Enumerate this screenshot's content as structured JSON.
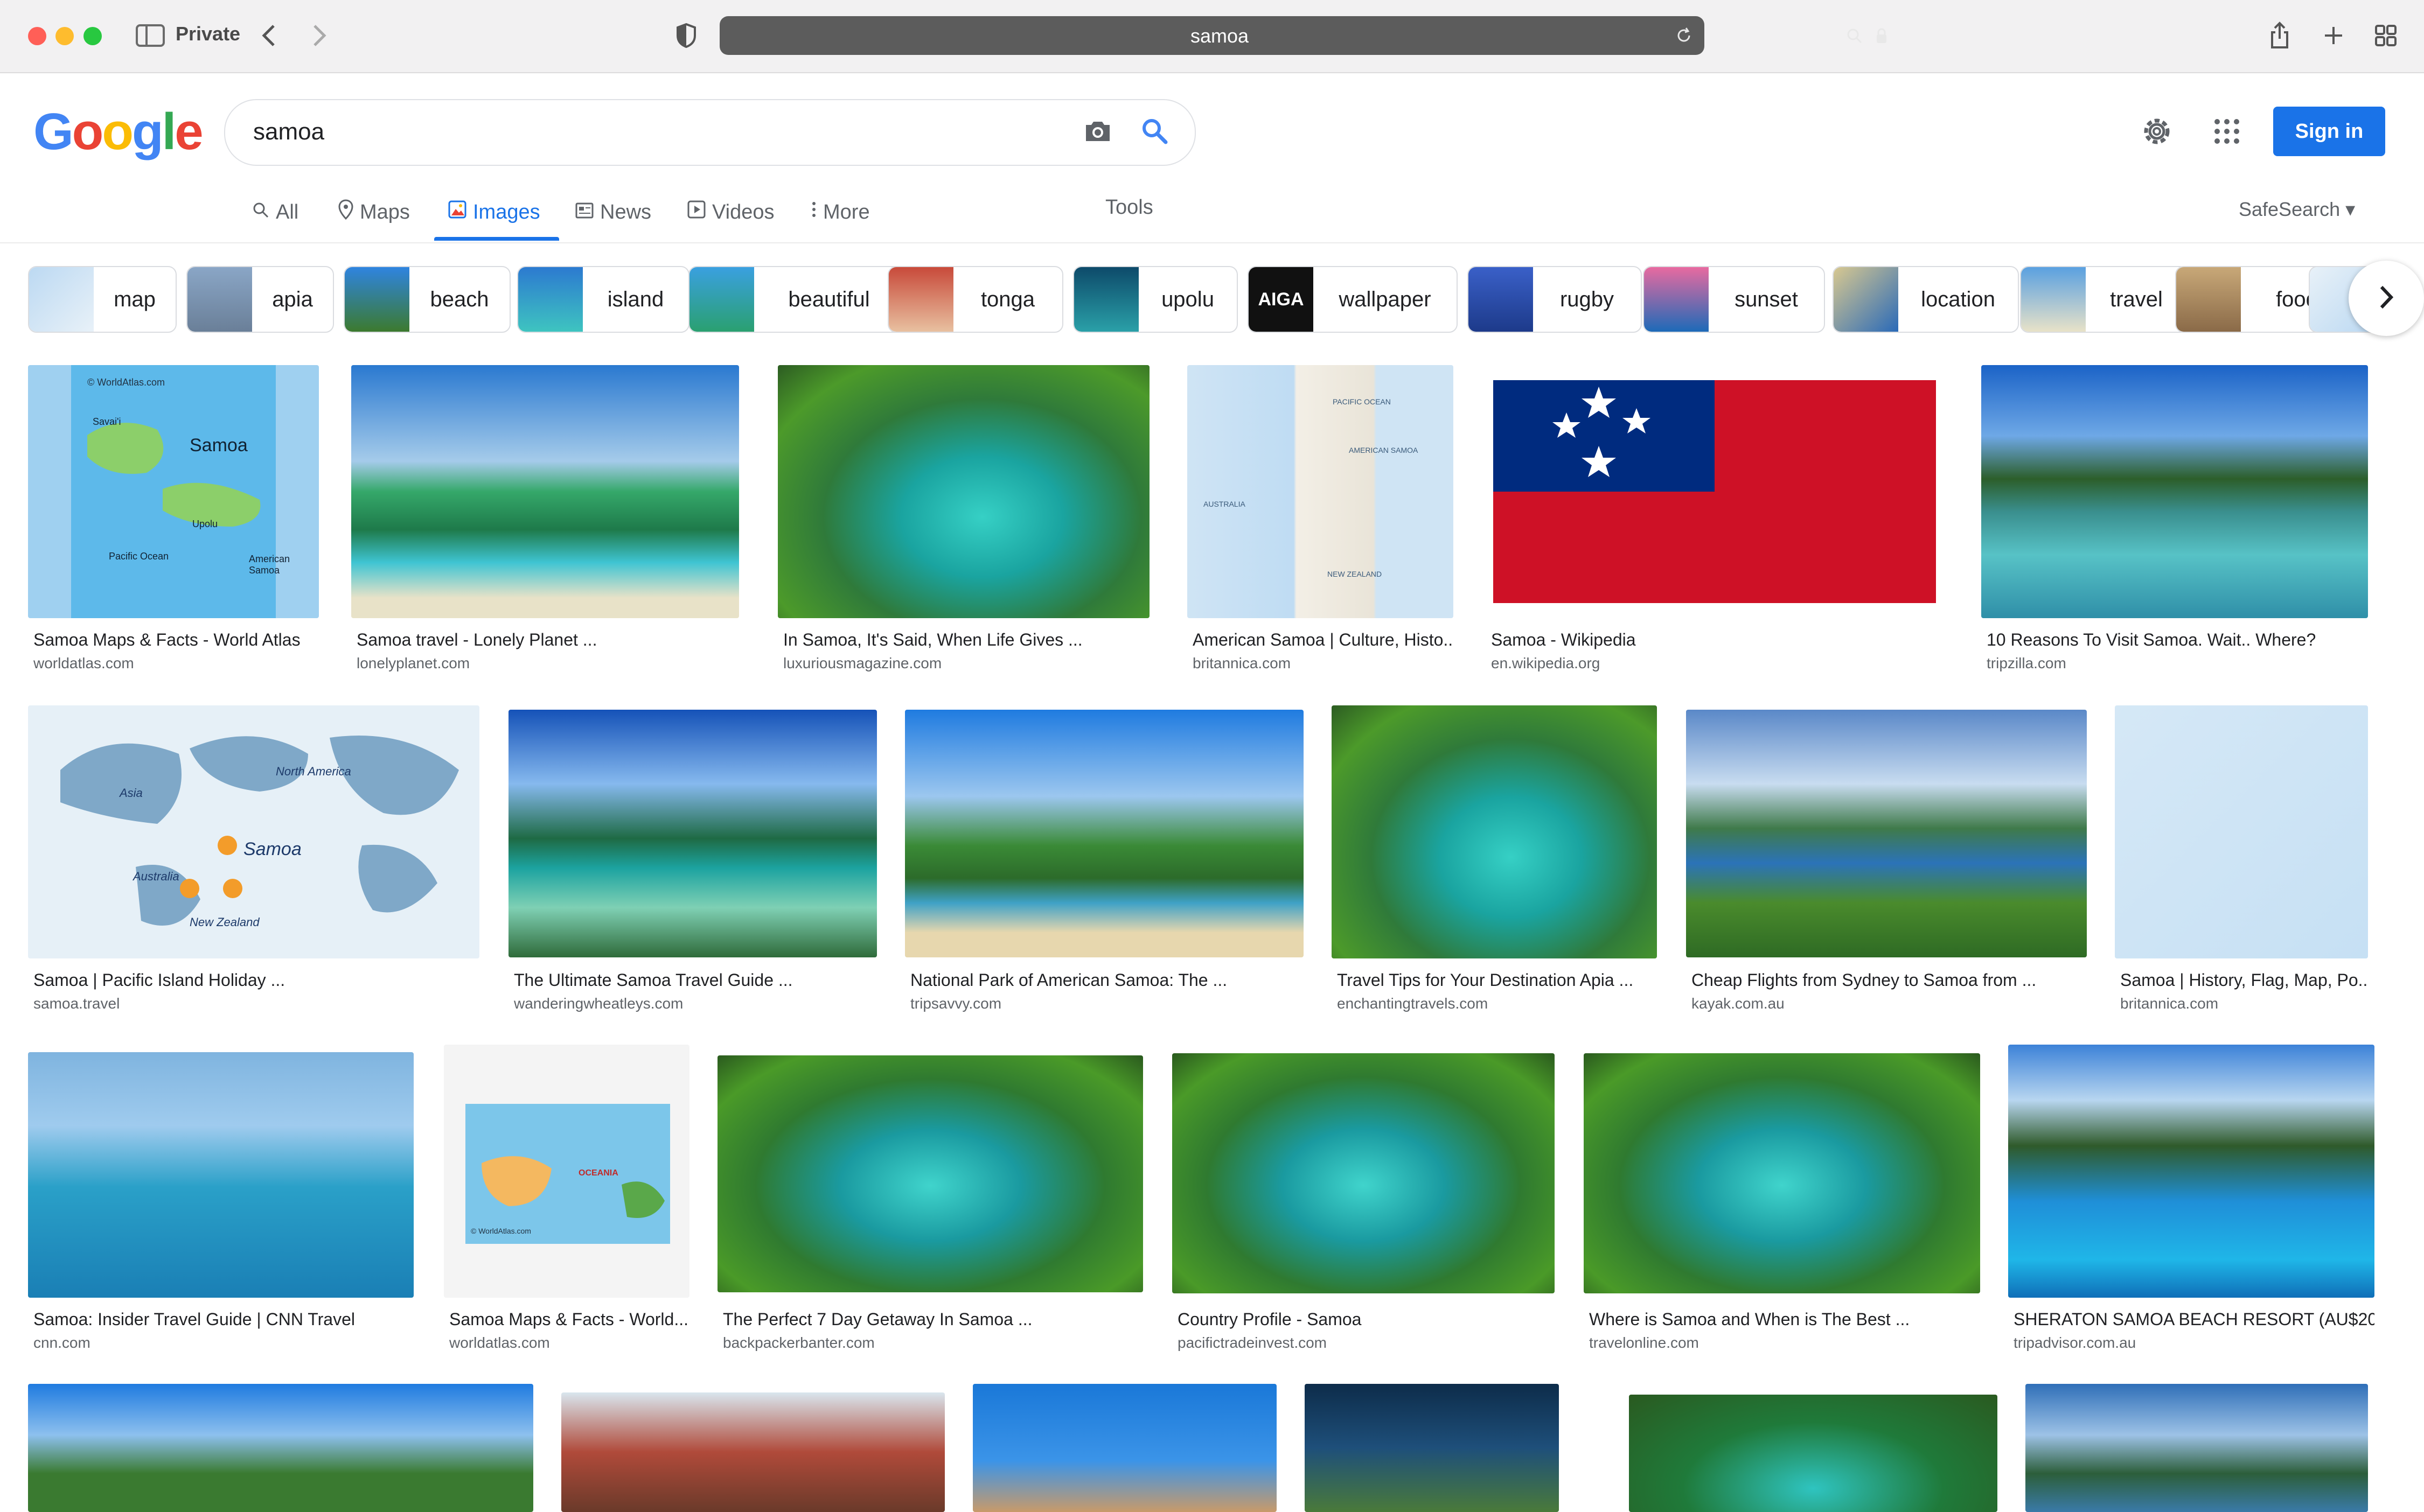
{
  "browser": {
    "mode_label": "Private",
    "url": "samoa"
  },
  "google": {
    "logo_letters": [
      "G",
      "o",
      "o",
      "g",
      "l",
      "e"
    ],
    "logo_colors": [
      "#4285f4",
      "#ea4335",
      "#fbbc05",
      "#4285f4",
      "#34a853",
      "#ea4335"
    ],
    "search_value": "samoa",
    "sign_in_label": "Sign in",
    "accent": "#1a73e8"
  },
  "tabs": {
    "items": [
      {
        "label": "All",
        "icon": "search-icon"
      },
      {
        "label": "Maps",
        "icon": "map-pin-icon"
      },
      {
        "label": "Images",
        "icon": "image-icon",
        "active": true
      },
      {
        "label": "News",
        "icon": "newspaper-icon"
      },
      {
        "label": "Videos",
        "icon": "play-icon"
      },
      {
        "label": "More",
        "icon": "kebab-icon"
      }
    ],
    "tools_label": "Tools",
    "safesearch_label": "SafeSearch"
  },
  "chips": [
    {
      "label": "map"
    },
    {
      "label": "apia"
    },
    {
      "label": "beach"
    },
    {
      "label": "island"
    },
    {
      "label": "beautiful"
    },
    {
      "label": "tonga"
    },
    {
      "label": "upolu"
    },
    {
      "label": "wallpaper"
    },
    {
      "label": "rugby"
    },
    {
      "label": "sunset"
    },
    {
      "label": "location"
    },
    {
      "label": "travel"
    },
    {
      "label": "food"
    }
  ],
  "results": [
    {
      "title": "Samoa Maps & Facts - World Atlas",
      "site": "worldatlas.com"
    },
    {
      "title": "Samoa travel - Lonely Planet ...",
      "site": "lonelyplanet.com"
    },
    {
      "title": "In Samoa, It's Said, When Life Gives ...",
      "site": "luxuriousmagazine.com"
    },
    {
      "title": "American Samoa | Culture, Histo...",
      "site": "britannica.com"
    },
    {
      "title": "Samoa - Wikipedia",
      "site": "en.wikipedia.org"
    },
    {
      "title": "10 Reasons To Visit Samoa. Wait.. Where?",
      "site": "tripzilla.com"
    },
    {
      "title": "Samoa | Pacific Island Holiday ...",
      "site": "samoa.travel"
    },
    {
      "title": "The Ultimate Samoa Travel Guide ...",
      "site": "wanderingwheatleys.com"
    },
    {
      "title": "National Park of American Samoa: The ...",
      "site": "tripsavvy.com"
    },
    {
      "title": "Travel Tips for Your Destination Apia ...",
      "site": "enchantingtravels.com"
    },
    {
      "title": "Cheap Flights from Sydney to Samoa from ...",
      "site": "kayak.com.au"
    },
    {
      "title": "Samoa | History, Flag, Map, Po...",
      "site": "britannica.com"
    },
    {
      "title": "Samoa: Insider Travel Guide | CNN Travel",
      "site": "cnn.com"
    },
    {
      "title": "Samoa Maps & Facts - World...",
      "site": "worldatlas.com"
    },
    {
      "title": "The Perfect 7 Day Getaway In Samoa ...",
      "site": "backpackerbanter.com"
    },
    {
      "title": "Country Profile - Samoa",
      "site": "pacifictradeinvest.com"
    },
    {
      "title": "Where is Samoa and When is The Best ...",
      "site": "travelonline.com"
    },
    {
      "title": "SHERATON SAMOA BEACH RESORT (AU$20...",
      "site": "tripadvisor.com.au"
    }
  ],
  "image_text": {
    "map_label": "Samoa",
    "map_credit": "© WorldAtlas.com",
    "samoa_map_places": [
      "Savai'i",
      "Upolu",
      "Pacific Ocean",
      "American Samoa"
    ],
    "pacific_map_labels": [
      "PACIFIC OCEAN",
      "AMERICAN SAMOA",
      "AUSTRALIA",
      "NEW ZEALAND"
    ],
    "worldmap_places": [
      "Samoa",
      "North America",
      "Asia",
      "Australia",
      "New Zealand"
    ],
    "oceania_label": "OCEANIA",
    "wallpaper_chip_text": "AIGA"
  }
}
